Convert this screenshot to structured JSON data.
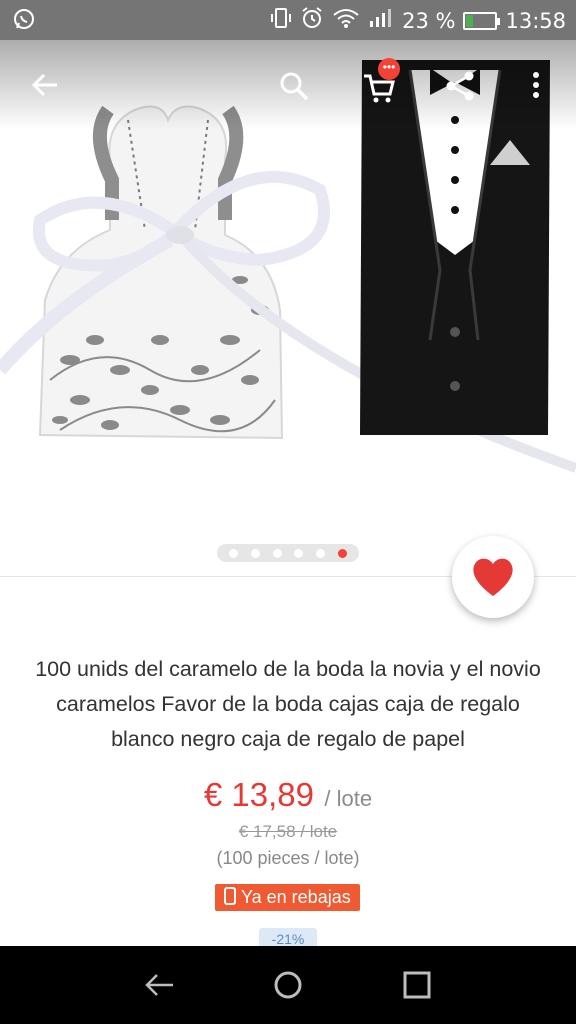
{
  "status_bar": {
    "battery_percent": "23 %",
    "time": "13:58",
    "battery_level": 0.23,
    "icons": [
      "whatsapp-icon",
      "vibrate-icon",
      "alarm-icon",
      "wifi-icon",
      "signal-icon",
      "battery-charging-icon"
    ]
  },
  "toolbar": {
    "icons": [
      "back-arrow-icon",
      "search-icon",
      "cart-icon",
      "share-icon",
      "more-vert-icon"
    ],
    "cart_badge": "•••"
  },
  "gallery": {
    "image_count": 6,
    "active_index": 5
  },
  "product": {
    "title": "100 unids del caramelo de la boda la novia y el novio caramelos Favor de la boda cajas caja de regalo blanco negro caja de regalo de papel",
    "price": "€ 13,89",
    "price_unit": "/ lote",
    "original_price": "€ 17,58 / lote",
    "pieces": "(100 pieces / lote)",
    "sale_badge": "Ya en rebajas",
    "discount": "-21%"
  },
  "favorite": {
    "icon": "heart-icon",
    "active": true
  },
  "colors": {
    "accent": "#f44336",
    "price": "#e53935",
    "sale_badge": "#f05a32",
    "status_bar": "#757575"
  },
  "nav_bar": {
    "icons": [
      "nav-back-icon",
      "nav-home-icon",
      "nav-recents-icon"
    ]
  }
}
